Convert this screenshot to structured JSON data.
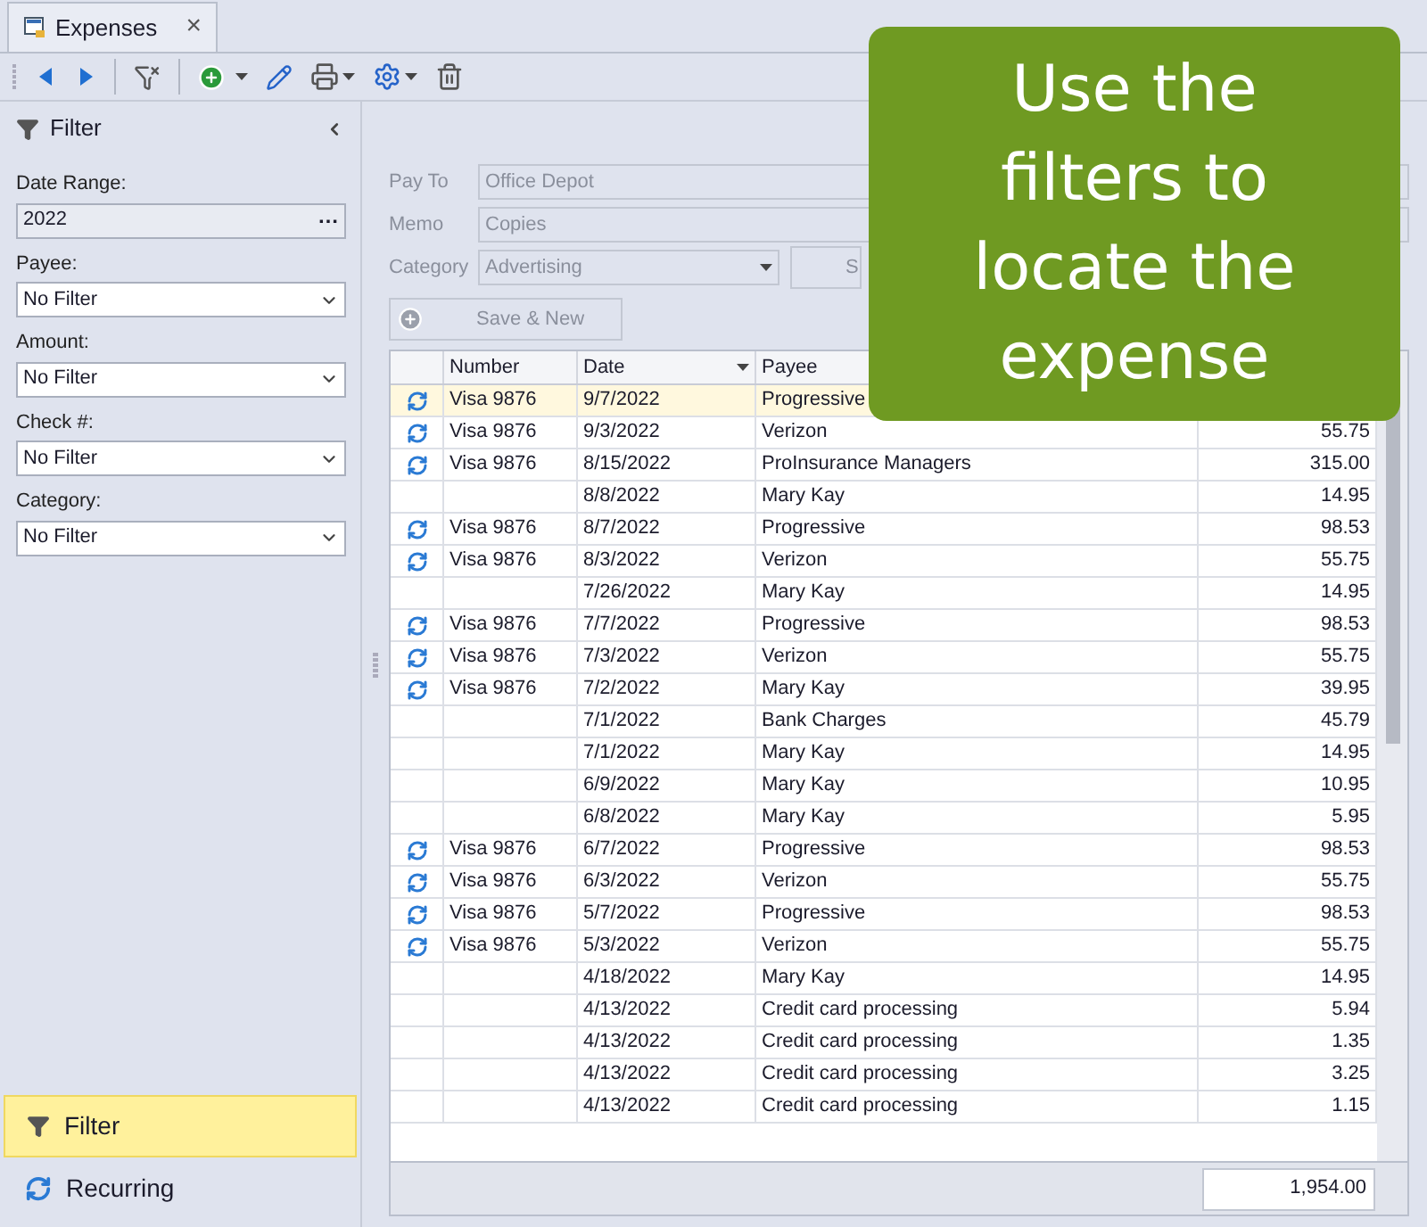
{
  "tab": {
    "title": "Expenses",
    "close": "×"
  },
  "filter_panel": {
    "title": "Filter",
    "fields": [
      {
        "label": "Date Range:",
        "value": "2022",
        "kind": "ellipsis",
        "button": "…"
      },
      {
        "label": "Payee:",
        "value": "No Filter",
        "kind": "dropdown"
      },
      {
        "label": "Amount:",
        "value": "No Filter",
        "kind": "dropdown"
      },
      {
        "label": "Check #:",
        "value": "No Filter",
        "kind": "dropdown"
      },
      {
        "label": "Category:",
        "value": "No Filter",
        "kind": "dropdown"
      }
    ]
  },
  "nav": [
    {
      "label": "Filter",
      "kind": "filter",
      "selected": true
    },
    {
      "label": "Recurring",
      "kind": "recurring",
      "selected": false
    }
  ],
  "form": {
    "disabled": true,
    "pay_to": {
      "label": "Pay To",
      "value": "Office Depot"
    },
    "memo": {
      "label": "Memo",
      "value": "Copies"
    },
    "category": {
      "label": "Category",
      "value": "Advertising"
    },
    "button_partial": "S",
    "save_new": "Save & New"
  },
  "table": {
    "columns": [
      "Number",
      "Date",
      "Payee"
    ],
    "rows": [
      {
        "recurring": true,
        "number": "Visa 9876",
        "date": "9/7/2022",
        "payee": "Progressive",
        "selected": true
      },
      {
        "recurring": true,
        "number": "Visa 9876",
        "date": "9/3/2022",
        "payee": "Verizon",
        "amount": "55.75",
        "selected": false
      },
      {
        "recurring": true,
        "number": "Visa 9876",
        "date": "8/15/2022",
        "payee": "ProInsurance Managers",
        "amount": "315.00",
        "selected": false
      },
      {
        "recurring": false,
        "number": "",
        "date": "8/8/2022",
        "payee": "Mary Kay",
        "amount": "14.95",
        "selected": false
      },
      {
        "recurring": true,
        "number": "Visa 9876",
        "date": "8/7/2022",
        "payee": "Progressive",
        "amount": "98.53",
        "selected": false
      },
      {
        "recurring": true,
        "number": "Visa 9876",
        "date": "8/3/2022",
        "payee": "Verizon",
        "amount": "55.75",
        "selected": false
      },
      {
        "recurring": false,
        "number": "",
        "date": "7/26/2022",
        "payee": "Mary Kay",
        "amount": "14.95",
        "selected": false
      },
      {
        "recurring": true,
        "number": "Visa 9876",
        "date": "7/7/2022",
        "payee": "Progressive",
        "amount": "98.53",
        "selected": false
      },
      {
        "recurring": true,
        "number": "Visa 9876",
        "date": "7/3/2022",
        "payee": "Verizon",
        "amount": "55.75",
        "selected": false
      },
      {
        "recurring": true,
        "number": "Visa 9876",
        "date": "7/2/2022",
        "payee": "Mary Kay",
        "amount": "39.95",
        "selected": false
      },
      {
        "recurring": false,
        "number": "",
        "date": "7/1/2022",
        "payee": "Bank Charges",
        "amount": "45.79",
        "selected": false
      },
      {
        "recurring": false,
        "number": "",
        "date": "7/1/2022",
        "payee": "Mary Kay",
        "amount": "14.95",
        "selected": false
      },
      {
        "recurring": false,
        "number": "",
        "date": "6/9/2022",
        "payee": "Mary Kay",
        "amount": "10.95",
        "selected": false
      },
      {
        "recurring": false,
        "number": "",
        "date": "6/8/2022",
        "payee": "Mary Kay",
        "amount": "5.95",
        "selected": false
      },
      {
        "recurring": true,
        "number": "Visa 9876",
        "date": "6/7/2022",
        "payee": "Progressive",
        "amount": "98.53",
        "selected": false
      },
      {
        "recurring": true,
        "number": "Visa 9876",
        "date": "6/3/2022",
        "payee": "Verizon",
        "amount": "55.75",
        "selected": false
      },
      {
        "recurring": true,
        "number": "Visa 9876",
        "date": "5/7/2022",
        "payee": "Progressive",
        "amount": "98.53",
        "selected": false
      },
      {
        "recurring": true,
        "number": "Visa 9876",
        "date": "5/3/2022",
        "payee": "Verizon",
        "amount": "55.75",
        "selected": false
      },
      {
        "recurring": false,
        "number": "",
        "date": "4/18/2022",
        "payee": "Mary Kay",
        "amount": "14.95",
        "selected": false
      },
      {
        "recurring": false,
        "number": "",
        "date": "4/13/2022",
        "payee": "Credit card processing",
        "amount": "5.94",
        "selected": false
      },
      {
        "recurring": false,
        "number": "",
        "date": "4/13/2022",
        "payee": "Credit card processing",
        "amount": "1.35",
        "selected": false
      },
      {
        "recurring": false,
        "number": "",
        "date": "4/13/2022",
        "payee": "Credit card processing",
        "amount": "3.25",
        "selected": false
      },
      {
        "recurring": false,
        "number": "",
        "date": "4/13/2022",
        "payee": "Credit card processing",
        "amount": "1.15",
        "selected": false
      }
    ],
    "total": "1,954.00"
  },
  "callout": "Use the filters to locate the expense"
}
